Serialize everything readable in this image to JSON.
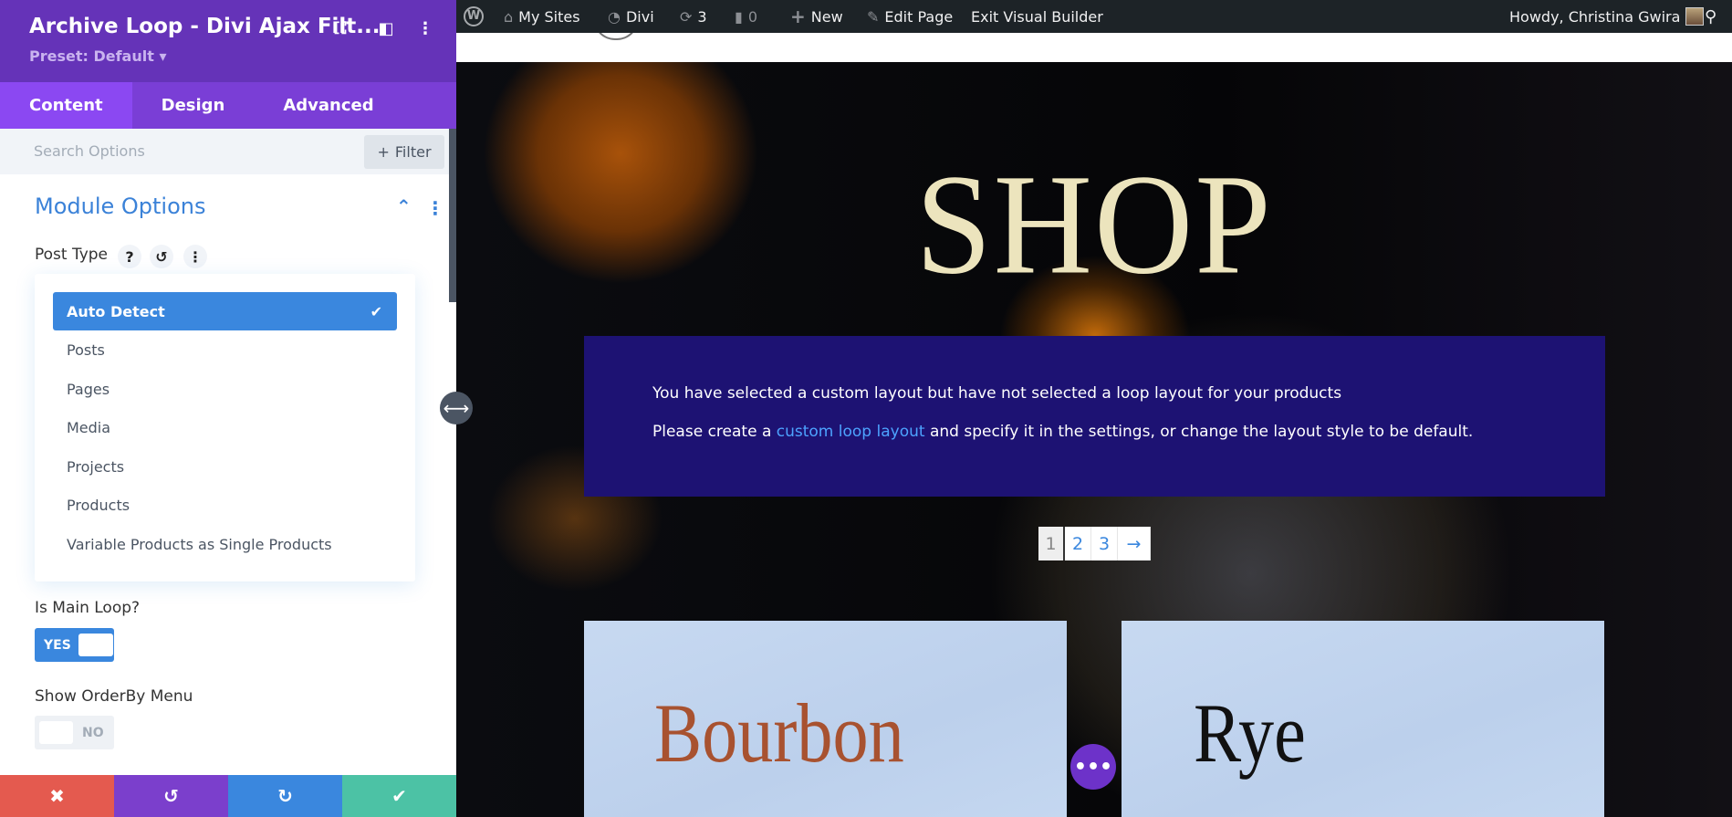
{
  "panel": {
    "title": "Archive Loop - Divi Ajax Filt...",
    "preset": "Preset: Default ▾",
    "tabs": [
      "Content",
      "Design",
      "Advanced"
    ],
    "search_placeholder": "Search Options",
    "filter_label": "Filter",
    "section_title": "Module Options",
    "post_type_label": "Post Type",
    "post_type_options": [
      "Auto Detect",
      "Posts",
      "Pages",
      "Media",
      "Projects",
      "Products",
      "Variable Products as Single Products"
    ],
    "selected_option": "Auto Detect",
    "is_main_loop_label": "Is Main Loop?",
    "is_main_loop_value": "YES",
    "show_orderby_label": "Show OrderBy Menu",
    "show_orderby_value": "NO"
  },
  "admin_bar": {
    "my_sites": "My Sites",
    "site": "Divi",
    "updates": "3",
    "comments": "0",
    "new": "New",
    "edit_page": "Edit Page",
    "exit_builder": "Exit Visual Builder",
    "howdy": "Howdy, Christina Gwira"
  },
  "page": {
    "title": "SHOP",
    "notice_line1": "You have selected a custom layout but have not selected a loop layout for your products",
    "notice_line2_pre": "Please create a ",
    "notice_link": "custom loop layout",
    "notice_line2_post": " and specify it in the settings, or change the layout style to be default.",
    "pagination": [
      "1",
      "2",
      "3",
      "→"
    ],
    "current_page": "1",
    "cards": [
      "Bourbon",
      "Rye"
    ]
  },
  "colors": {
    "purple": "#6533b8",
    "blue": "#3a87de",
    "notice_bg": "#1d1273",
    "bourbon": "#a85230"
  }
}
